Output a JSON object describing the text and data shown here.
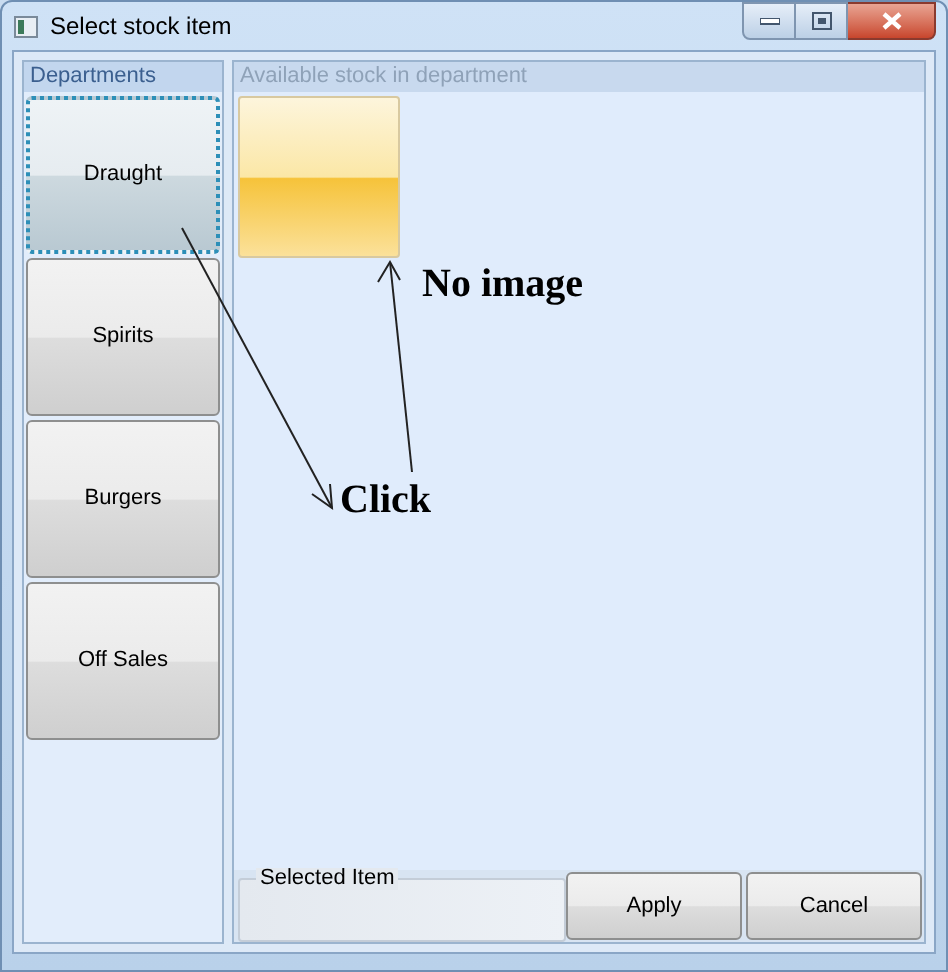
{
  "window": {
    "title": "Select stock item"
  },
  "departments": {
    "title": "Departments",
    "items": [
      {
        "label": "Draught",
        "selected": true
      },
      {
        "label": "Spirits",
        "selected": false
      },
      {
        "label": "Burgers",
        "selected": false
      },
      {
        "label": "Off Sales",
        "selected": false
      }
    ]
  },
  "stock": {
    "title": "Available stock in department",
    "items": [
      {
        "kind": "tile"
      }
    ]
  },
  "selected_item": {
    "title": "Selected Item"
  },
  "buttons": [
    "Apply",
    "Cancel"
  ],
  "annotations": [
    {
      "text": "No image"
    },
    {
      "text": "Click"
    }
  ]
}
